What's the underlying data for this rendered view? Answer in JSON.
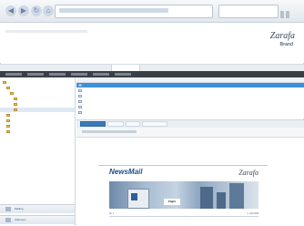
{
  "browser": {
    "nav_icons": [
      "back-icon",
      "forward-icon",
      "refresh-icon",
      "home-icon"
    ]
  },
  "app": {
    "brand_line1": "Zarafa",
    "brand_line2": "Brand"
  },
  "tabs": [
    "",
    "",
    "",
    "",
    ""
  ],
  "sidebar": {
    "footer_items": [
      "Mailing",
      "Adressen"
    ]
  },
  "list": {
    "rows": [
      {
        "selected": true
      },
      {
        "selected": false
      },
      {
        "selected": false
      },
      {
        "selected": false
      },
      {
        "selected": false
      },
      {
        "selected": false
      },
      {
        "selected": false
      }
    ]
  },
  "preview": {
    "tabs": [
      "",
      "",
      "",
      ""
    ],
    "newsletter": {
      "title": "NewsMail",
      "brand": "Zarafa",
      "badge": "Flight",
      "issue": "Nr. 1",
      "date": "1. Juli 2009"
    }
  },
  "colors": {
    "selected_row": "#3d8fd9",
    "toolbar": "#3a3f46",
    "active_tab": "#3b79b8",
    "folder": "#e8c35a",
    "newsletter_title": "#1f4e8a"
  }
}
